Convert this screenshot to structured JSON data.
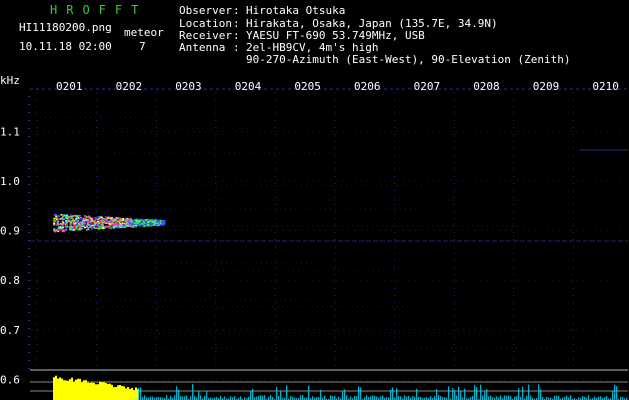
{
  "header": {
    "title": "HROFFT",
    "filename": "HI11180200.png",
    "meteor_label": "meteor",
    "datetime": "10.11.18 02:00",
    "meteor_count": "7",
    "info": [
      {
        "label": "Observer",
        "sep": ":",
        "value": "Hirotaka Otsuka"
      },
      {
        "label": "Location",
        "sep": ":",
        "value": "Hirakata, Osaka, Japan (135.7E, 34.9N)"
      },
      {
        "label": "Receiver",
        "sep": ":",
        "value": "YAESU FT-690 53.749MHz, USB"
      },
      {
        "label": "Antenna",
        "sep": ":",
        "value": "2el-HB9CV, 4m's high"
      },
      {
        "label": "",
        "sep": "",
        "value": "90-270-Azimuth (East-West), 90-Elevation (Zenith)"
      }
    ]
  },
  "chart_data": {
    "type": "heatmap",
    "ylabel": "kHz",
    "y_ticks": [
      "1.1",
      "1.0",
      "0.9",
      "0.8",
      "0.7",
      "0.6"
    ],
    "x_ticks": [
      "0201",
      "0202",
      "0203",
      "0204",
      "0205",
      "0206",
      "0207",
      "0208",
      "0209",
      "0210"
    ],
    "echo": {
      "start_min": 0.0,
      "end_min": 2.3,
      "freq_khz": 0.905
    },
    "colors": {
      "title": "#33cc33",
      "echo_hot": "#ff2020",
      "echo_mid": "#40ff40",
      "echo_cool": "#3050ff",
      "bars": "#ffff00",
      "baseline": "#00e0ff",
      "grid": "#3838c8"
    }
  }
}
